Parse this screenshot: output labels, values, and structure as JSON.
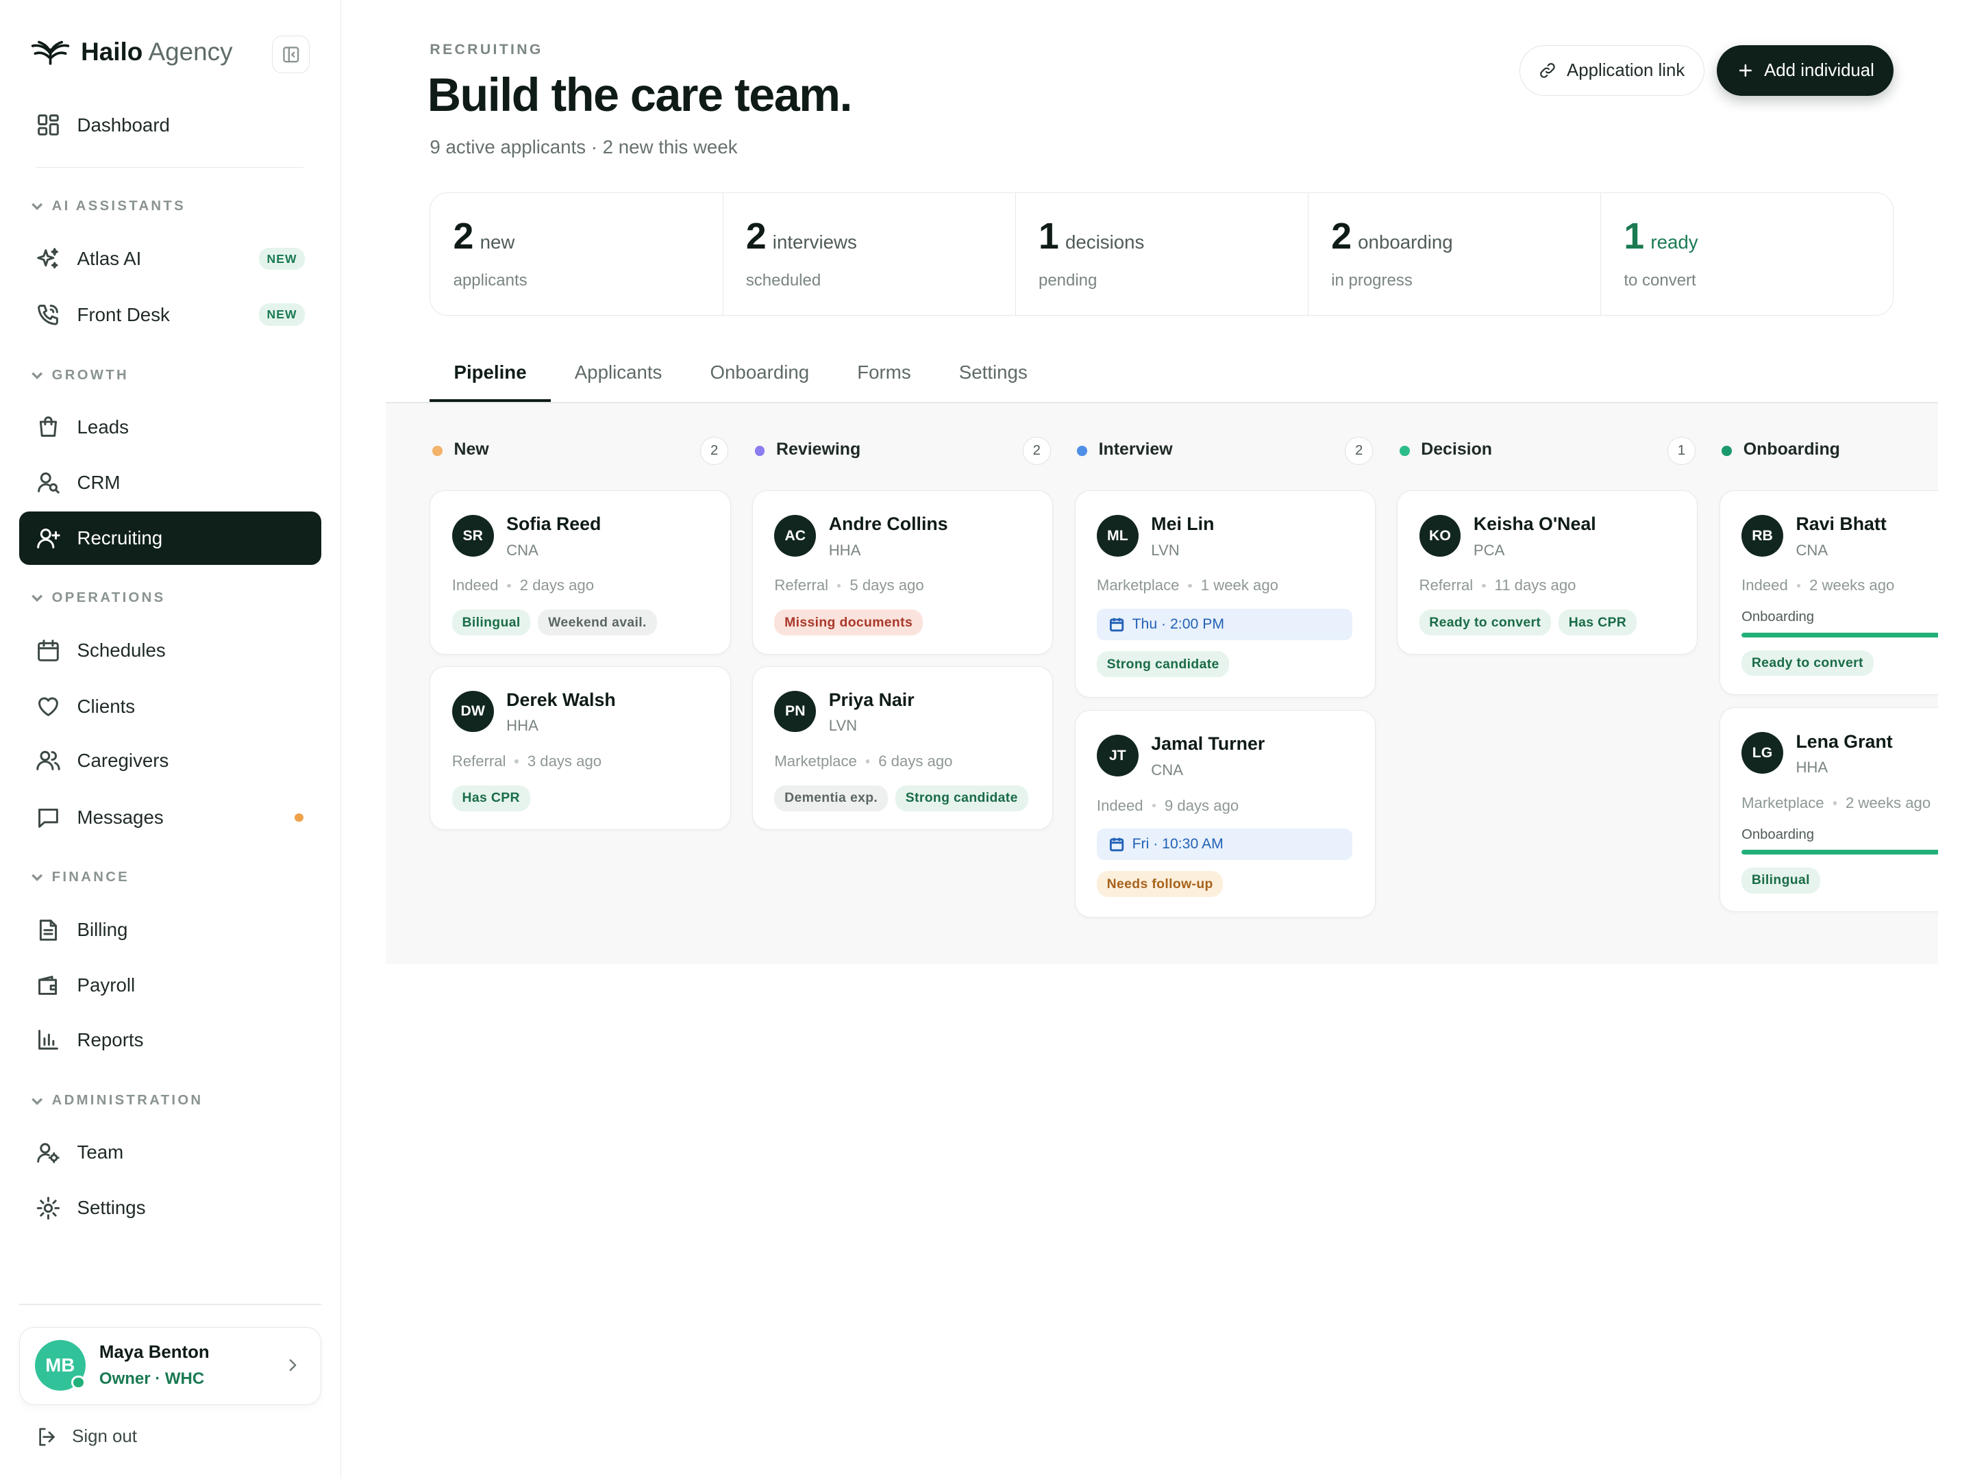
{
  "brand": {
    "name_bold": "Hailo",
    "name_light": "Agency"
  },
  "sidebar": {
    "dashboard": "Dashboard",
    "sections": {
      "ai": "AI ASSISTANTS",
      "growth": "GROWTH",
      "operations": "OPERATIONS",
      "finance": "FINANCE",
      "administration": "ADMINISTRATION"
    },
    "items": {
      "atlas": "Atlas AI",
      "front_desk": "Front Desk",
      "leads": "Leads",
      "crm": "CRM",
      "recruiting": "Recruiting",
      "schedules": "Schedules",
      "clients": "Clients",
      "caregivers": "Caregivers",
      "messages": "Messages",
      "billing": "Billing",
      "payroll": "Payroll",
      "reports": "Reports",
      "team": "Team",
      "settings": "Settings"
    },
    "new_badge": "NEW",
    "user": {
      "initials": "MB",
      "name": "Maya Benton",
      "role": "Owner · WHC"
    },
    "sign_out": "Sign out"
  },
  "header": {
    "eyebrow": "RECRUITING",
    "title": "Build the care team.",
    "subtitle": "9 active applicants · 2 new this week",
    "app_link": "Application link",
    "add_individual": "Add individual"
  },
  "stats": [
    {
      "num": "2",
      "label": "new",
      "sub": "applicants"
    },
    {
      "num": "2",
      "label": "interviews",
      "sub": "scheduled"
    },
    {
      "num": "1",
      "label": "decisions",
      "sub": "pending"
    },
    {
      "num": "2",
      "label": "onboarding",
      "sub": "in progress"
    },
    {
      "num": "1",
      "label": "ready",
      "sub": "to convert"
    }
  ],
  "tabs": [
    "Pipeline",
    "Applicants",
    "Onboarding",
    "Forms",
    "Settings"
  ],
  "columns": [
    {
      "name": "New",
      "count": "2",
      "color": "#f3b36b"
    },
    {
      "name": "Reviewing",
      "count": "2",
      "color": "#8b7cf0"
    },
    {
      "name": "Interview",
      "count": "2",
      "color": "#4f8fe8"
    },
    {
      "name": "Decision",
      "count": "1",
      "color": "#2dbd8a"
    },
    {
      "name": "Onboarding",
      "count": "",
      "color": "#1a9a6c"
    }
  ],
  "cards": {
    "sofia": {
      "initials": "SR",
      "name": "Sofia Reed",
      "role": "CNA",
      "source": "Indeed",
      "time": "2 days ago",
      "tags": [
        "Bilingual",
        "Weekend avail."
      ]
    },
    "derek": {
      "initials": "DW",
      "name": "Derek Walsh",
      "role": "HHA",
      "source": "Referral",
      "time": "3 days ago",
      "tags": [
        "Has CPR"
      ]
    },
    "andre": {
      "initials": "AC",
      "name": "Andre Collins",
      "role": "HHA",
      "source": "Referral",
      "time": "5 days ago",
      "tags": [
        "Missing documents"
      ]
    },
    "priya": {
      "initials": "PN",
      "name": "Priya Nair",
      "role": "LVN",
      "source": "Marketplace",
      "time": "6 days ago",
      "tags": [
        "Dementia exp.",
        "Strong candidate"
      ]
    },
    "mei": {
      "initials": "ML",
      "name": "Mei Lin",
      "role": "LVN",
      "source": "Marketplace",
      "time": "1 week ago",
      "schedule": "Thu · 2:00 PM",
      "tags": [
        "Strong candidate"
      ]
    },
    "jamal": {
      "initials": "JT",
      "name": "Jamal Turner",
      "role": "CNA",
      "source": "Indeed",
      "time": "9 days ago",
      "schedule": "Fri · 10:30 AM",
      "tags": [
        "Needs follow-up"
      ]
    },
    "keisha": {
      "initials": "KO",
      "name": "Keisha O'Neal",
      "role": "PCA",
      "source": "Referral",
      "time": "11 days ago",
      "tags": [
        "Ready to convert",
        "Has CPR"
      ]
    },
    "ravi": {
      "initials": "RB",
      "name": "Ravi Bhatt",
      "role": "CNA",
      "source": "Indeed",
      "time": "2 weeks ago",
      "onboarding_label": "Onboarding",
      "progress": 1.0,
      "tags": [
        "Ready to convert"
      ]
    },
    "lena": {
      "initials": "LG",
      "name": "Lena Grant",
      "role": "HHA",
      "source": "Marketplace",
      "time": "2 weeks ago",
      "onboarding_label": "Onboarding",
      "progress": 0.75,
      "tags": [
        "Bilingual"
      ]
    }
  }
}
